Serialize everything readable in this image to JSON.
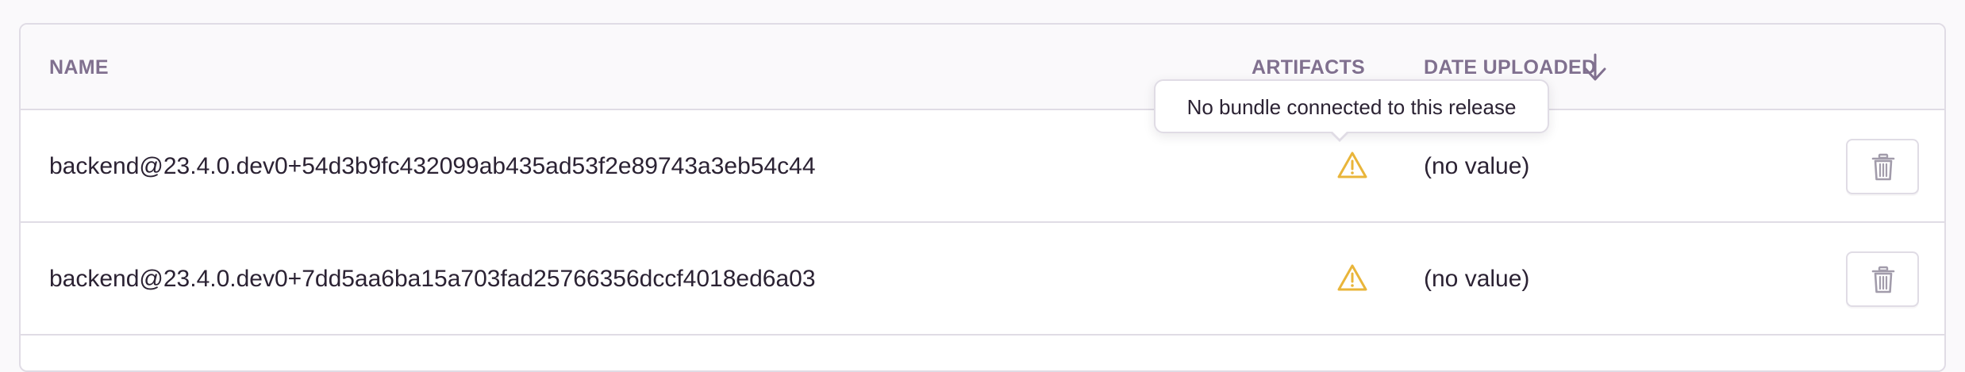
{
  "table": {
    "columns": {
      "name": "Name",
      "artifacts": "Artifacts",
      "date_uploaded": "Date Uploaded"
    },
    "sort": {
      "column": "date_uploaded",
      "direction": "descending",
      "icon": "arrow-down-icon"
    },
    "rows": [
      {
        "name": "backend@23.4.0.dev0+54d3b9fc432099ab435ad53f2e89743a3eb54c44",
        "artifacts_icon": "warning-icon",
        "date_uploaded": "(no value)",
        "action_icon": "trash-icon"
      },
      {
        "name": "backend@23.4.0.dev0+7dd5aa6ba15a703fad25766356dccf4018ed6a03",
        "artifacts_icon": "warning-icon",
        "date_uploaded": "(no value)",
        "action_icon": "trash-icon"
      }
    ]
  },
  "tooltip": {
    "text": "No bundle connected to this release"
  },
  "colors": {
    "warning": "#e9b53a",
    "header_text": "#80708f",
    "body_text": "#2b2233",
    "border": "#e0dce5",
    "icon_muted": "#a29cab"
  }
}
